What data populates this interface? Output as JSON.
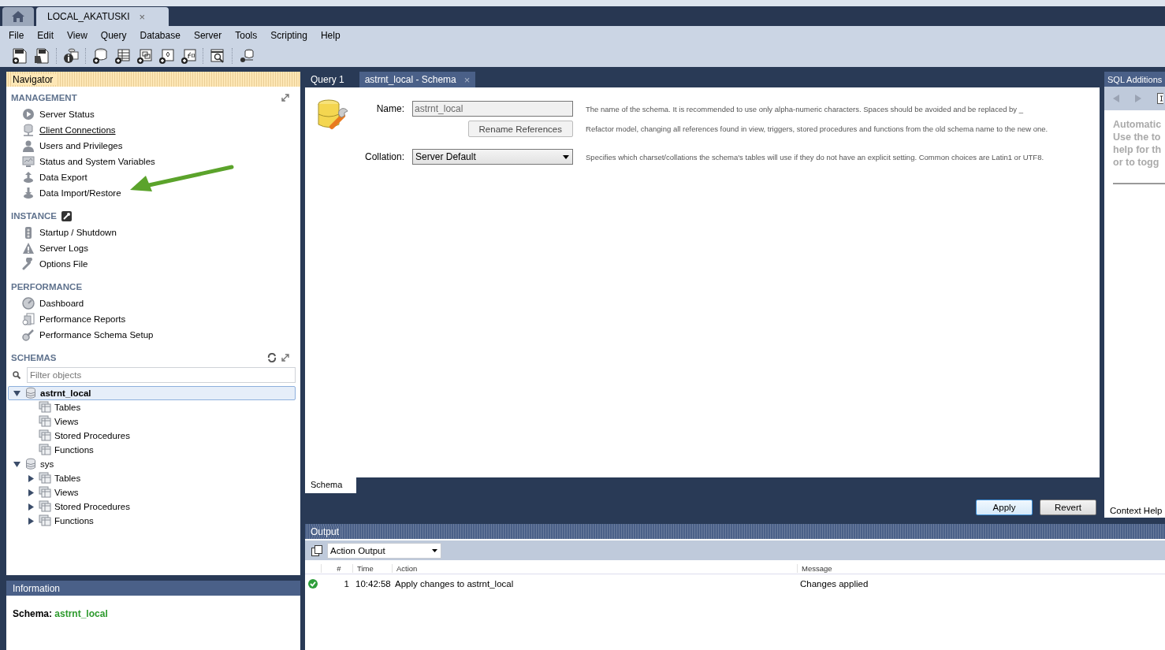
{
  "app_tabs": [
    {
      "kind": "home",
      "selected": false
    },
    {
      "kind": "connection",
      "label": "LOCAL_AKATUSKI",
      "close": "×",
      "selected": true
    }
  ],
  "menu": [
    "File",
    "Edit",
    "View",
    "Query",
    "Database",
    "Server",
    "Tools",
    "Scripting",
    "Help"
  ],
  "navigator": {
    "title": "Navigator",
    "sections": [
      {
        "title": "MANAGEMENT",
        "kind": "management",
        "items": [
          {
            "label": "Server Status",
            "kind": "status",
            "hovered": false
          },
          {
            "label": "Client Connections",
            "kind": "connections",
            "hovered": true
          },
          {
            "label": "Users and Privileges",
            "kind": "users",
            "hovered": false
          },
          {
            "label": "Status and System Variables",
            "kind": "variables",
            "hovered": false
          },
          {
            "label": "Data Export",
            "kind": "export",
            "hovered": false
          },
          {
            "label": "Data Import/Restore",
            "kind": "import",
            "hovered": false
          }
        ]
      },
      {
        "title": "INSTANCE",
        "kind": "instance",
        "items": [
          {
            "label": "Startup / Shutdown",
            "kind": "startup",
            "hovered": false
          },
          {
            "label": "Server Logs",
            "kind": "logs",
            "hovered": false
          },
          {
            "label": "Options File",
            "kind": "options",
            "hovered": false
          }
        ]
      },
      {
        "title": "PERFORMANCE",
        "kind": "performance",
        "items": [
          {
            "label": "Dashboard",
            "kind": "dashboard",
            "hovered": false
          },
          {
            "label": "Performance Reports",
            "kind": "reports",
            "hovered": false
          },
          {
            "label": "Performance Schema Setup",
            "kind": "setup",
            "hovered": false
          }
        ]
      }
    ]
  },
  "schemas": {
    "title": "SCHEMAS",
    "filter": {
      "placeholder": "Filter objects"
    },
    "tree": [
      {
        "label": "astrnt_local",
        "selected": true,
        "expanded": true,
        "children": [
          {
            "label": "Tables",
            "kind": "folder"
          },
          {
            "label": "Views",
            "kind": "folder"
          },
          {
            "label": "Stored Procedures",
            "kind": "folder"
          },
          {
            "label": "Functions",
            "kind": "folder"
          }
        ]
      },
      {
        "label": "sys",
        "selected": false,
        "expanded": true,
        "children": [
          {
            "label": "Tables",
            "kind": "folder",
            "expanded": false
          },
          {
            "label": "Views",
            "kind": "folder",
            "expanded": false
          },
          {
            "label": "Stored Procedures",
            "kind": "folder",
            "expanded": false
          },
          {
            "label": "Functions",
            "kind": "folder",
            "expanded": false
          }
        ]
      }
    ]
  },
  "information": {
    "title": "Information",
    "label": "Schema:",
    "value": "astrnt_local"
  },
  "editor": {
    "tabs": [
      {
        "label": "Query 1",
        "selected": false
      },
      {
        "label": "astrnt_local - Schema",
        "close": "×",
        "selected": true
      }
    ],
    "name_label": "Name:",
    "name_value": "astrnt_local",
    "name_disabled": true,
    "rename_button": "Rename References",
    "collation_label": "Collation:",
    "collation_value": "Server Default",
    "name_hint": "The name of the schema. It is recommended to use only alpha-numeric characters. Spaces should be avoided and be replaced by _",
    "rename_hint": "Refactor model, changing all references found in view, triggers, stored procedures and functions from the old schema name to the new one.",
    "collation_hint": "Specifies which charset/collations the schema's tables will use if they do not have an explicit setting. Common choices are Latin1 or UTF8.",
    "bottom_tabs": [
      {
        "label": "Schema",
        "selected": true
      }
    ],
    "buttons": [
      {
        "label": "Apply",
        "default": true
      },
      {
        "label": "Revert",
        "default": false
      }
    ]
  },
  "sql_additions": {
    "title": "SQL Additions",
    "help_lines": [
      "Automatic",
      "Use the to",
      "help for th",
      "or to togg"
    ],
    "bottom_tab": "Context Help"
  },
  "output": {
    "title": "Output",
    "selector": "Action Output",
    "columns": [
      "",
      "#",
      "Time",
      "Action",
      "Message"
    ],
    "rows": [
      {
        "success": true,
        "number": "1",
        "time": "10:42:58",
        "action": "Apply changes to astrnt_local",
        "message": "Changes applied"
      }
    ]
  }
}
